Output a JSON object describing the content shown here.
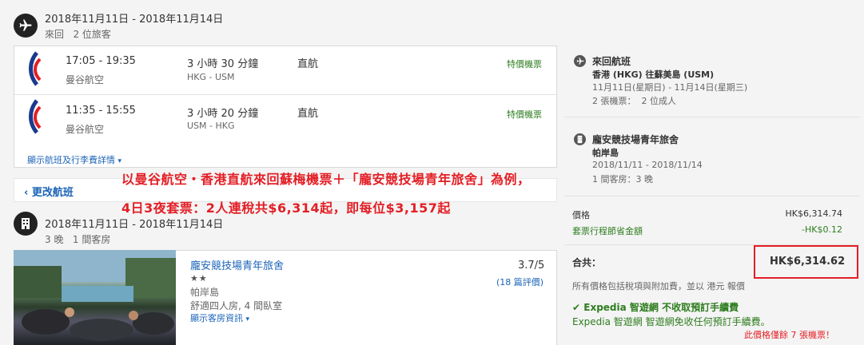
{
  "flight_section": {
    "dates": "2018年11月11日 - 2018年11月14日",
    "trip_info": "來回   2 位旅客",
    "legs": [
      {
        "time": "17:05 - 19:35",
        "airline": "曼谷航空",
        "duration": "3 小時 30 分鐘",
        "route": "HKG - USM",
        "stops": "直航",
        "fare": "特價機票"
      },
      {
        "time": "11:35 - 15:55",
        "airline": "曼谷航空",
        "duration": "3 小時 20 分鐘",
        "route": "USM - HKG",
        "stops": "直航",
        "fare": "特價機票"
      }
    ],
    "details_link": "顯示航班及行李費詳情",
    "change_flight": "更改航班"
  },
  "hotel_section": {
    "dates": "2018年11月11日 - 2018年11月14日",
    "stay_info": "3 晚   1 間客房",
    "hotel_name": "龐安競技場青年旅舍",
    "stars": "★★",
    "location": "帕岸島",
    "room": "舒適四人房, 4 間臥室",
    "room_link": "顯示客房資訊",
    "rating": "3.7/5",
    "reviews": "(18 篇評價)"
  },
  "annotation": {
    "line1": "以曼谷航空・香港直航來回蘇梅機票＋「龐安競技場青年旅舍」為例，",
    "line2": "4日3夜套票：2人連稅共$6,314起，即每位$3,157起"
  },
  "summary": {
    "flight_title": "來回航班",
    "flight_route": "香港 (HKG) 往蘇美島 (USM)",
    "flight_dates": "11月11日(星期日) - 11月14日(星期三)",
    "flight_tickets": "2 張機票：  2 位成人",
    "hotel_title": "龐安競技場青年旅舍",
    "hotel_location": "帕岸島",
    "hotel_dates": "2018/11/11 - 2018/11/14",
    "hotel_rooms": "1 間客房：3 晚",
    "price_label": "價格",
    "price_value": "HK$6,314.74",
    "saving_label": "套票行程節省金額",
    "saving_value": "-HK$0.12",
    "total_label": "合共：",
    "total_value": "HK$6,314.62",
    "tax_note": "所有價格包括稅項與附加費，並以 港元 報價",
    "no_fee_title": "Expedia 智遊網 不收取預訂手續費",
    "no_fee_desc": "Expedia 智遊網 智遊網免收任何預訂手續費。",
    "tickets_left": "此價格僅餘 7 張機票！"
  }
}
